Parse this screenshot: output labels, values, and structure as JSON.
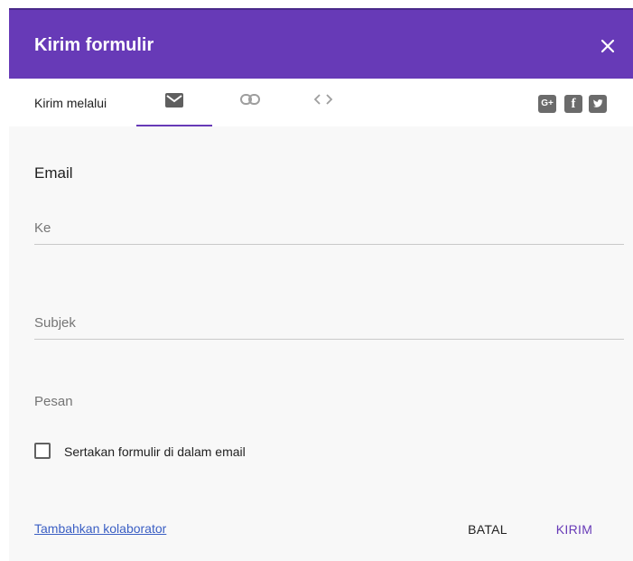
{
  "dialog": {
    "title": "Kirim formulir",
    "close_icon": "close-icon"
  },
  "tabbar": {
    "send_via_label": "Kirim melalui",
    "tabs": [
      {
        "name": "email",
        "icon": "mail-icon",
        "selected": true
      },
      {
        "name": "link",
        "icon": "link-icon",
        "selected": false
      },
      {
        "name": "embed",
        "icon": "embed-code-icon",
        "selected": false
      }
    ],
    "social": [
      {
        "name": "google-plus",
        "glyph": "G+"
      },
      {
        "name": "facebook",
        "glyph": "f"
      },
      {
        "name": "twitter",
        "icon": "twitter-bird-icon"
      }
    ]
  },
  "email_form": {
    "section_title": "Email",
    "to": {
      "placeholder": "Ke",
      "value": ""
    },
    "subject": {
      "placeholder": "Subjek",
      "value": ""
    },
    "message": {
      "placeholder": "Pesan",
      "value": ""
    },
    "include_form": {
      "label": "Sertakan formulir di dalam email",
      "checked": false
    }
  },
  "footer": {
    "add_collaborators": "Tambahkan kolaborator",
    "cancel": "BATAL",
    "send": "KIRIM"
  },
  "colors": {
    "header": "#673ab7",
    "accent": "#673ab7",
    "link": "#3b5fc4"
  }
}
